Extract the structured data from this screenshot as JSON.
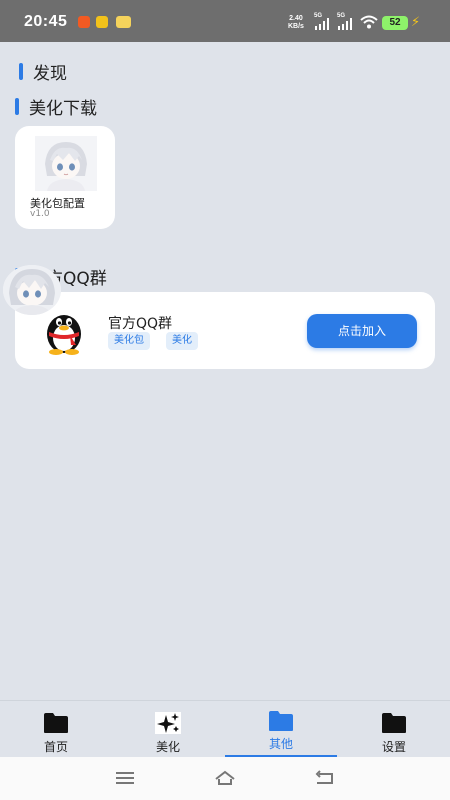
{
  "status_bar": {
    "time": "20:45",
    "net_speed_value": "2.40",
    "net_speed_unit": "KB/s",
    "signal_1": "5G",
    "signal_2": "5G",
    "battery": "52"
  },
  "page": {
    "title": "发现"
  },
  "beauty_section": {
    "title": "美化下载",
    "item": {
      "name": "美化包配置",
      "version": "v1.0"
    }
  },
  "qq_section": {
    "title": "官方QQ群",
    "card": {
      "title": "官方QQ群",
      "tags": [
        "美化包",
        "美化"
      ],
      "button": "点击加入"
    }
  },
  "bottom_nav": {
    "items": [
      {
        "label": "首页",
        "icon": "folder-icon"
      },
      {
        "label": "美化",
        "icon": "sparkle-icon"
      },
      {
        "label": "其他",
        "icon": "folder-icon"
      },
      {
        "label": "设置",
        "icon": "folder-icon"
      }
    ],
    "active_index": 2
  },
  "colors": {
    "accent": "#2c7be5",
    "background": "#dfe3ea"
  }
}
